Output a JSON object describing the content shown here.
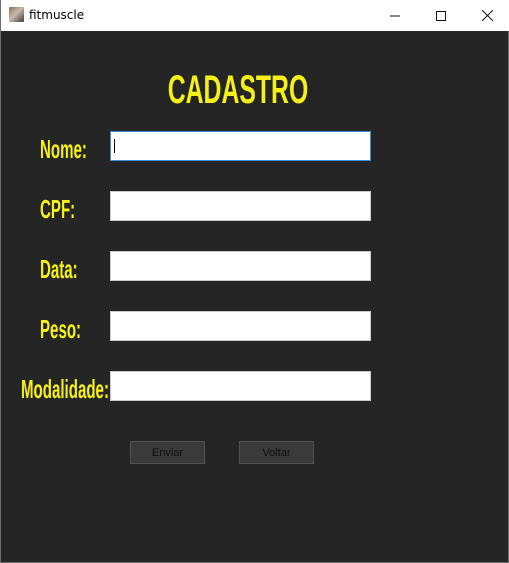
{
  "window": {
    "title": "fitmuscle",
    "icon": "app-photo-icon",
    "controls": [
      "minimize-icon",
      "maximize-icon",
      "close-icon"
    ]
  },
  "form": {
    "heading": "CADASTRO",
    "fields": [
      {
        "label": "Nome:",
        "value": "",
        "focused": true
      },
      {
        "label": "CPF:",
        "value": ""
      },
      {
        "label": "Data:",
        "value": ""
      },
      {
        "label": "Peso:",
        "value": ""
      },
      {
        "label": "Modalidade:",
        "value": ""
      }
    ],
    "buttons": {
      "submit": "Enviar",
      "back": "Voltar"
    }
  },
  "colors": {
    "background": "#252525",
    "label_text": "#f5f01a",
    "focus_border": "#3c8fd6"
  }
}
